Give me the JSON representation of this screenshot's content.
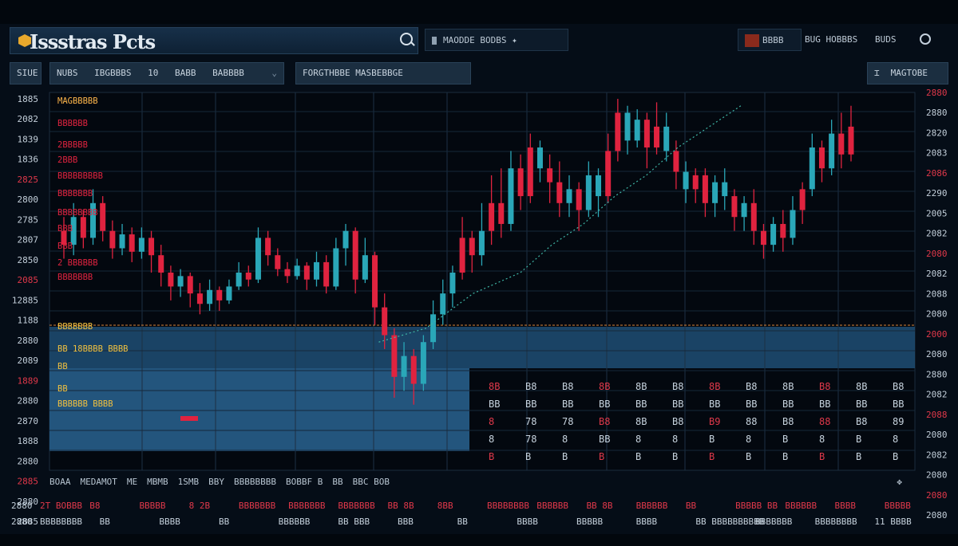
{
  "app": {
    "title": "Issstras Pcts"
  },
  "header": {
    "center_label": "MAODDE BODBS",
    "right_badge": "BBBB",
    "right_tab_1": "BUG HOBBBS",
    "right_tab_2": "BUDS"
  },
  "toolbar": {
    "left_label": "SIUE",
    "group_items": [
      "NUBS",
      "IBGBBBS",
      "10",
      "BABB",
      "BABBBB"
    ],
    "middle_label": "FORGTHBBE MASBEBBGE",
    "right_label": "MAGTOBE"
  },
  "chart_data": {
    "type": "candlestick",
    "title": "",
    "left_axis_labels": [
      "1885",
      "2082",
      "1839",
      "1836",
      "2825",
      "2800",
      "2785",
      "2807",
      "2850",
      "2085",
      "12885",
      "1188",
      "2880",
      "2089",
      "1889",
      "2880",
      "2870",
      "1888",
      "2880",
      "2885",
      "2880",
      "2885"
    ],
    "right_axis_labels": [
      "2880",
      "2880",
      "2820",
      "2083",
      "2086",
      "2290",
      "2005",
      "2082",
      "2080",
      "2082",
      "2088",
      "2080",
      "2000",
      "2080",
      "2880",
      "2082",
      "2088",
      "2080",
      "2082",
      "2080",
      "2080",
      "2080"
    ],
    "ylim": [
      0,
      100
    ],
    "levels_left": [
      "MAGBBBBB",
      "BBBBBB",
      "2BBBBB",
      "2BBB",
      "BBBBBBBBB",
      "BBBBBBB",
      "BBBBBBBB",
      "BBB",
      "BBB",
      "2 BBBBBB",
      "BBBBBBB",
      "BBBBBBB",
      "BB 18BBBB BBBB",
      "BB",
      "BB",
      "BBBBBB BBBB"
    ],
    "candles": [
      {
        "o": 62,
        "c": 58,
        "h": 66,
        "l": 54,
        "up": false
      },
      {
        "o": 58,
        "c": 66,
        "h": 70,
        "l": 55,
        "up": true
      },
      {
        "o": 66,
        "c": 60,
        "h": 68,
        "l": 57,
        "up": false
      },
      {
        "o": 60,
        "c": 70,
        "h": 74,
        "l": 58,
        "up": true
      },
      {
        "o": 70,
        "c": 62,
        "h": 72,
        "l": 59,
        "up": false
      },
      {
        "o": 62,
        "c": 57,
        "h": 65,
        "l": 54,
        "up": false
      },
      {
        "o": 57,
        "c": 61,
        "h": 64,
        "l": 55,
        "up": true
      },
      {
        "o": 61,
        "c": 56,
        "h": 63,
        "l": 53,
        "up": false
      },
      {
        "o": 56,
        "c": 60,
        "h": 63,
        "l": 54,
        "up": true
      },
      {
        "o": 60,
        "c": 55,
        "h": 62,
        "l": 50,
        "up": false
      },
      {
        "o": 55,
        "c": 50,
        "h": 58,
        "l": 46,
        "up": false
      },
      {
        "o": 50,
        "c": 46,
        "h": 52,
        "l": 42,
        "up": false
      },
      {
        "o": 46,
        "c": 49,
        "h": 51,
        "l": 43,
        "up": true
      },
      {
        "o": 49,
        "c": 44,
        "h": 50,
        "l": 40,
        "up": false
      },
      {
        "o": 44,
        "c": 41,
        "h": 47,
        "l": 38,
        "up": false
      },
      {
        "o": 41,
        "c": 45,
        "h": 48,
        "l": 39,
        "up": true
      },
      {
        "o": 45,
        "c": 42,
        "h": 46,
        "l": 39,
        "up": false
      },
      {
        "o": 42,
        "c": 46,
        "h": 48,
        "l": 41,
        "up": true
      },
      {
        "o": 46,
        "c": 50,
        "h": 53,
        "l": 45,
        "up": true
      },
      {
        "o": 50,
        "c": 48,
        "h": 52,
        "l": 46,
        "up": false
      },
      {
        "o": 48,
        "c": 60,
        "h": 63,
        "l": 47,
        "up": true
      },
      {
        "o": 60,
        "c": 55,
        "h": 62,
        "l": 52,
        "up": false
      },
      {
        "o": 55,
        "c": 51,
        "h": 57,
        "l": 49,
        "up": false
      },
      {
        "o": 51,
        "c": 49,
        "h": 53,
        "l": 47,
        "up": false
      },
      {
        "o": 49,
        "c": 52,
        "h": 54,
        "l": 48,
        "up": true
      },
      {
        "o": 52,
        "c": 48,
        "h": 53,
        "l": 45,
        "up": false
      },
      {
        "o": 48,
        "c": 53,
        "h": 56,
        "l": 46,
        "up": true
      },
      {
        "o": 53,
        "c": 46,
        "h": 55,
        "l": 44,
        "up": false
      },
      {
        "o": 46,
        "c": 57,
        "h": 60,
        "l": 45,
        "up": true
      },
      {
        "o": 57,
        "c": 62,
        "h": 64,
        "l": 52,
        "up": true
      },
      {
        "o": 62,
        "c": 48,
        "h": 63,
        "l": 44,
        "up": false
      },
      {
        "o": 48,
        "c": 55,
        "h": 60,
        "l": 47,
        "up": true
      },
      {
        "o": 55,
        "c": 40,
        "h": 56,
        "l": 35,
        "up": false
      },
      {
        "o": 40,
        "c": 32,
        "h": 44,
        "l": 28,
        "up": false
      },
      {
        "o": 32,
        "c": 20,
        "h": 34,
        "l": 14,
        "up": false
      },
      {
        "o": 20,
        "c": 26,
        "h": 30,
        "l": 16,
        "up": true
      },
      {
        "o": 26,
        "c": 18,
        "h": 28,
        "l": 12,
        "up": false
      },
      {
        "o": 18,
        "c": 30,
        "h": 32,
        "l": 16,
        "up": true
      },
      {
        "o": 30,
        "c": 38,
        "h": 42,
        "l": 28,
        "up": true
      },
      {
        "o": 38,
        "c": 44,
        "h": 48,
        "l": 35,
        "up": true
      },
      {
        "o": 44,
        "c": 50,
        "h": 52,
        "l": 40,
        "up": true
      },
      {
        "o": 50,
        "c": 60,
        "h": 66,
        "l": 48,
        "up": false
      },
      {
        "o": 60,
        "c": 55,
        "h": 62,
        "l": 50,
        "up": false
      },
      {
        "o": 55,
        "c": 62,
        "h": 70,
        "l": 52,
        "up": true
      },
      {
        "o": 62,
        "c": 70,
        "h": 78,
        "l": 58,
        "up": false
      },
      {
        "o": 70,
        "c": 64,
        "h": 80,
        "l": 60,
        "up": false
      },
      {
        "o": 64,
        "c": 80,
        "h": 85,
        "l": 62,
        "up": true
      },
      {
        "o": 80,
        "c": 72,
        "h": 84,
        "l": 68,
        "up": false
      },
      {
        "o": 72,
        "c": 86,
        "h": 90,
        "l": 70,
        "up": false
      },
      {
        "o": 86,
        "c": 80,
        "h": 88,
        "l": 76,
        "up": true
      },
      {
        "o": 80,
        "c": 76,
        "h": 84,
        "l": 70,
        "up": false
      },
      {
        "o": 76,
        "c": 70,
        "h": 82,
        "l": 66,
        "up": false
      },
      {
        "o": 70,
        "c": 74,
        "h": 78,
        "l": 66,
        "up": true
      },
      {
        "o": 74,
        "c": 68,
        "h": 76,
        "l": 62,
        "up": false
      },
      {
        "o": 68,
        "c": 78,
        "h": 82,
        "l": 66,
        "up": true
      },
      {
        "o": 78,
        "c": 72,
        "h": 80,
        "l": 66,
        "up": true
      },
      {
        "o": 72,
        "c": 85,
        "h": 90,
        "l": 70,
        "up": false
      },
      {
        "o": 85,
        "c": 96,
        "h": 100,
        "l": 82,
        "up": false
      },
      {
        "o": 96,
        "c": 88,
        "h": 98,
        "l": 84,
        "up": true
      },
      {
        "o": 88,
        "c": 94,
        "h": 97,
        "l": 86,
        "up": true
      },
      {
        "o": 94,
        "c": 86,
        "h": 96,
        "l": 80,
        "up": false
      },
      {
        "o": 86,
        "c": 92,
        "h": 99,
        "l": 84,
        "up": false
      },
      {
        "o": 92,
        "c": 85,
        "h": 96,
        "l": 82,
        "up": true
      },
      {
        "o": 85,
        "c": 79,
        "h": 88,
        "l": 74,
        "up": false
      },
      {
        "o": 79,
        "c": 74,
        "h": 82,
        "l": 70,
        "up": true
      },
      {
        "o": 74,
        "c": 78,
        "h": 80,
        "l": 70,
        "up": false
      },
      {
        "o": 78,
        "c": 70,
        "h": 80,
        "l": 66,
        "up": false
      },
      {
        "o": 70,
        "c": 76,
        "h": 78,
        "l": 66,
        "up": true
      },
      {
        "o": 76,
        "c": 72,
        "h": 80,
        "l": 68,
        "up": true
      },
      {
        "o": 72,
        "c": 66,
        "h": 74,
        "l": 62,
        "up": false
      },
      {
        "o": 66,
        "c": 70,
        "h": 72,
        "l": 62,
        "up": true
      },
      {
        "o": 70,
        "c": 62,
        "h": 74,
        "l": 58,
        "up": false
      },
      {
        "o": 62,
        "c": 58,
        "h": 64,
        "l": 54,
        "up": false
      },
      {
        "o": 58,
        "c": 64,
        "h": 66,
        "l": 56,
        "up": true
      },
      {
        "o": 64,
        "c": 60,
        "h": 68,
        "l": 56,
        "up": false
      },
      {
        "o": 60,
        "c": 68,
        "h": 72,
        "l": 58,
        "up": true
      },
      {
        "o": 68,
        "c": 74,
        "h": 76,
        "l": 64,
        "up": false
      },
      {
        "o": 74,
        "c": 86,
        "h": 90,
        "l": 72,
        "up": true
      },
      {
        "o": 86,
        "c": 80,
        "h": 88,
        "l": 76,
        "up": false
      },
      {
        "o": 80,
        "c": 90,
        "h": 94,
        "l": 78,
        "up": true
      },
      {
        "o": 90,
        "c": 84,
        "h": 96,
        "l": 80,
        "up": false
      },
      {
        "o": 84,
        "c": 92,
        "h": 98,
        "l": 82,
        "up": false
      }
    ],
    "trend_points": [
      [
        40,
        30
      ],
      [
        46,
        34
      ],
      [
        52,
        44
      ],
      [
        58,
        50
      ],
      [
        62,
        58
      ],
      [
        66,
        64
      ],
      [
        70,
        72
      ],
      [
        74,
        78
      ],
      [
        78,
        86
      ],
      [
        82,
        92
      ],
      [
        86,
        98
      ]
    ]
  },
  "table": {
    "rows": [
      [
        "8B",
        "B8",
        "B8",
        "8B",
        "8B",
        "B8",
        "8B",
        "B8",
        "8B",
        "B8",
        "8B",
        "B8"
      ],
      [
        "BB",
        "BB",
        "BB",
        "BB",
        "BB",
        "BB",
        "BB",
        "BB",
        "BB",
        "BB",
        "BB",
        "BB"
      ],
      [
        "8",
        "78",
        "78",
        "B8",
        "8B",
        "B8",
        "B9",
        "88",
        "B8",
        "88",
        "B8",
        "89"
      ],
      [
        "8",
        "78",
        "8",
        "BB",
        "8",
        "8",
        "B",
        "8",
        "B",
        "8",
        "B",
        "8"
      ],
      [
        "B",
        "B",
        "B",
        "B",
        "B",
        "B",
        "B",
        "B",
        "B",
        "B",
        "B",
        "B"
      ]
    ]
  },
  "status": {
    "items": [
      "BOAA",
      "MEDAMOT",
      "ME",
      "MBMB",
      "1SMB",
      "BBY",
      "BBBBBBBB",
      "BOBBF B",
      "BB",
      "BBC BOB"
    ]
  },
  "bottom_rows": [
    [
      "2880",
      "2T BOBBB",
      "B8",
      "BBBBB",
      "8 2B",
      "BBBBBBB",
      "BBBBBBB",
      "BBBBBBB",
      "BB 8B",
      "8BB",
      "BBBBBBBB",
      "BBBBBB",
      "BB 8B",
      "BBBBBB",
      "BB",
      "BBBBB BB",
      "BBBBBB",
      "BBBB",
      "BBBBB"
    ],
    [
      "2880",
      "BBBBBBBB",
      "BB",
      "BBBB",
      "BB",
      "BBBBBB",
      "BB BBB",
      "BBB",
      "BB",
      "BBBB",
      "BBBBB",
      "BBBB",
      "BB BBBBBBBBBB",
      "BBBBBBB",
      "BBBBBBBB",
      "11 BBBB"
    ]
  ]
}
